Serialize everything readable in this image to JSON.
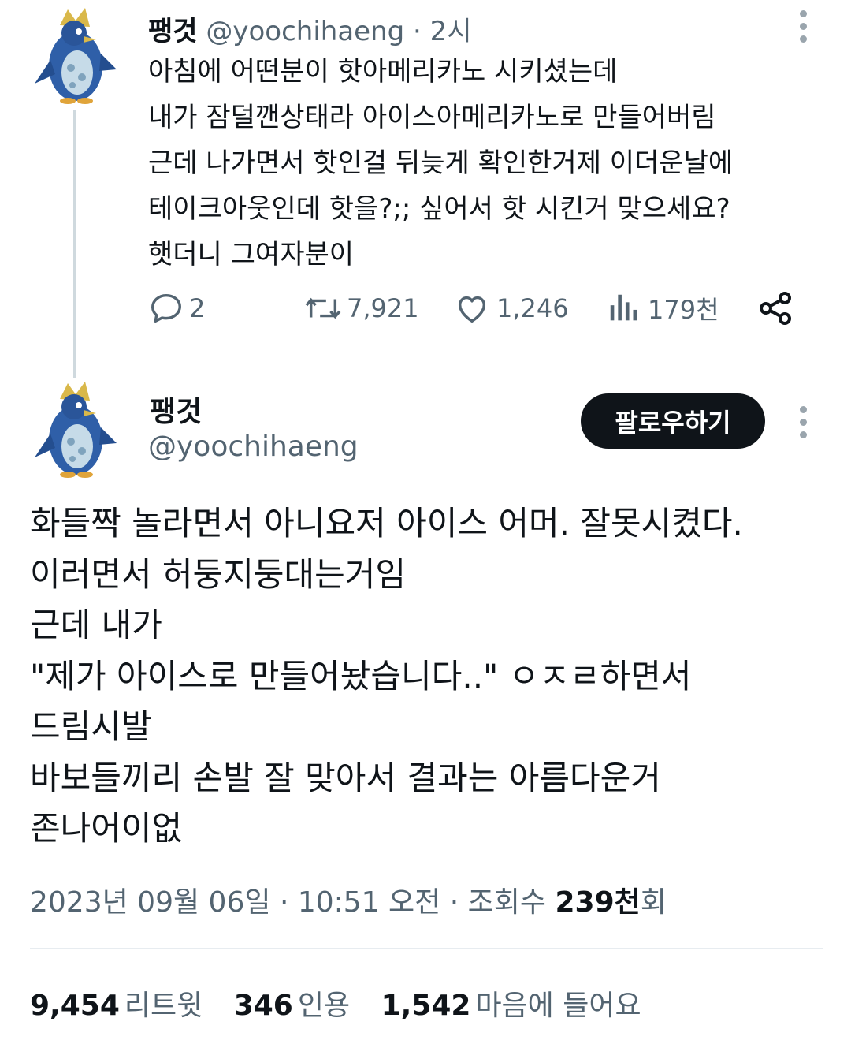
{
  "thread_tweet": {
    "author_name": "팽것",
    "handle": "@yoochihaeng",
    "separator": "·",
    "time": "2시",
    "lines": [
      "아침에 어떤분이 핫아메리카노 시키셨는데",
      "내가 잠덜깬상태라 아이스아메리카노로 만들어버림",
      "근데 나가면서 핫인걸 뒤늦게 확인한거제 이더운날에",
      "테이크아웃인데 핫을?;; 싶어서 핫 시킨거 맞으세요?",
      "햇더니 그여자분이"
    ],
    "actions": {
      "reply_count": "2",
      "retweet_count": "7,921",
      "like_count": "1,246",
      "views_count": "179천"
    }
  },
  "main_tweet": {
    "author_name": "팽것",
    "handle": "@yoochihaeng",
    "follow_label": "팔로우하기",
    "lines": [
      "화들짝 놀라면서 아니요저 아이스 어머. 잘못시켰다.",
      "이러면서 허둥지둥대는거임",
      "근데 내가",
      "\"제가 아이스로 만들어놨습니다..\" ㅇㅈㄹ하면서",
      "드림시발",
      "바보들끼리 손발 잘 맞아서 결과는 아름다운거",
      "존나어이없"
    ],
    "meta": {
      "date": "2023년 09월 06일",
      "separator": "·",
      "time": "10:51 오전",
      "views_label": "조회수",
      "views_value": "239천",
      "views_suffix": "회"
    },
    "stats": {
      "retweets": "9,454",
      "retweets_label": "리트윗",
      "quotes": "346",
      "quotes_label": "인용",
      "likes": "1,542",
      "likes_label": "마음에 들어요"
    }
  },
  "icons": {
    "reply": "speech-bubble-icon",
    "retweet": "retweet-arrows-icon",
    "like": "heart-icon",
    "views": "bar-chart-icon",
    "share": "share-icon",
    "more": "more-dots-icon",
    "avatar": "penguin-avatar"
  },
  "colors": {
    "text": "#0f1419",
    "secondary": "#536471",
    "thread_line": "#cfd9de",
    "follow_button_bg": "#0f1419",
    "follow_button_text": "#ffffff"
  }
}
